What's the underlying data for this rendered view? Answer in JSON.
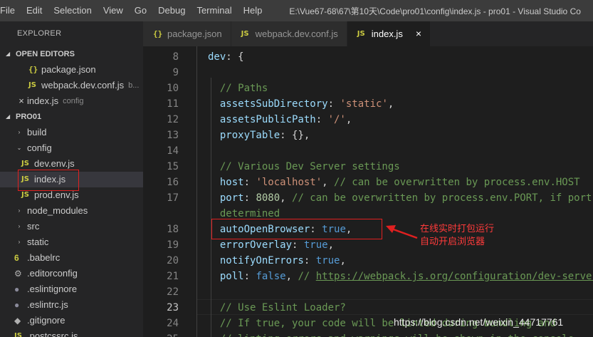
{
  "menubar": {
    "items": [
      "File",
      "Edit",
      "Selection",
      "View",
      "Go",
      "Debug",
      "Terminal",
      "Help"
    ],
    "title": "E:\\Vue67-68\\67\\第10天\\Code\\pro01\\config\\index.js - pro01 - Visual Studio Co"
  },
  "sidebar": {
    "explorer_label": "EXPLORER",
    "open_editors_label": "OPEN EDITORS",
    "open_editors": [
      {
        "icon": "{}",
        "name": "package.json",
        "desc": ""
      },
      {
        "icon": "JS",
        "name": "webpack.dev.conf.js",
        "desc": "b..."
      },
      {
        "icon": "×",
        "name": "index.js",
        "desc": "config"
      }
    ],
    "project_label": "PRO01",
    "tree": [
      {
        "twisty": "›",
        "icon": "",
        "name": "build"
      },
      {
        "twisty": "⌄",
        "icon": "",
        "name": "config"
      },
      {
        "twisty": "",
        "icon": "JS",
        "name": "dev.env.js"
      },
      {
        "twisty": "",
        "icon": "JS",
        "name": "index.js"
      },
      {
        "twisty": "",
        "icon": "JS",
        "name": "prod.env.js"
      },
      {
        "twisty": "›",
        "icon": "",
        "name": "node_modules"
      },
      {
        "twisty": "›",
        "icon": "",
        "name": "src"
      },
      {
        "twisty": "›",
        "icon": "",
        "name": "static"
      },
      {
        "twisty": "",
        "icon": "6",
        "name": ".babelrc"
      },
      {
        "twisty": "",
        "icon": "⚙",
        "name": ".editorconfig"
      },
      {
        "twisty": "",
        "icon": "●",
        "name": ".eslintignore"
      },
      {
        "twisty": "",
        "icon": "●",
        "name": ".eslintrc.js"
      },
      {
        "twisty": "",
        "icon": "◆",
        "name": ".gitignore"
      },
      {
        "twisty": "",
        "icon": "JS",
        "name": ".postcssrc.js"
      }
    ]
  },
  "tabs": [
    {
      "icon": "{}",
      "label": "package.json",
      "active": false
    },
    {
      "icon": "JS",
      "label": "webpack.dev.conf.js",
      "active": false
    },
    {
      "icon": "JS",
      "label": "index.js",
      "active": true,
      "close": "×"
    }
  ],
  "editor": {
    "lines": [
      {
        "no": "8",
        "parts": [
          [
            "k",
            "dev"
          ],
          [
            "p",
            ": {"
          ]
        ]
      },
      {
        "no": "9",
        "parts": []
      },
      {
        "no": "10",
        "parts": [
          [
            "c",
            "  // Paths"
          ]
        ]
      },
      {
        "no": "11",
        "parts": [
          [
            "k",
            "  assetsSubDirectory"
          ],
          [
            "p",
            ": "
          ],
          [
            "s",
            "'static'"
          ],
          [
            "p",
            ","
          ]
        ]
      },
      {
        "no": "12",
        "parts": [
          [
            "k",
            "  assetsPublicPath"
          ],
          [
            "p",
            ": "
          ],
          [
            "s",
            "'/'"
          ],
          [
            "p",
            ","
          ]
        ]
      },
      {
        "no": "13",
        "parts": [
          [
            "k",
            "  proxyTable"
          ],
          [
            "p",
            ": {},"
          ]
        ]
      },
      {
        "no": "14",
        "parts": []
      },
      {
        "no": "15",
        "parts": [
          [
            "c",
            "  // Various Dev Server settings"
          ]
        ]
      },
      {
        "no": "16",
        "parts": [
          [
            "k",
            "  host"
          ],
          [
            "p",
            ": "
          ],
          [
            "s",
            "'localhost'"
          ],
          [
            "p",
            ", "
          ],
          [
            "c",
            "// can be overwritten by process.env.HOST"
          ]
        ]
      },
      {
        "no": "17",
        "parts": [
          [
            "k",
            "  port"
          ],
          [
            "p",
            ": "
          ],
          [
            "n",
            "8080"
          ],
          [
            "p",
            ", "
          ],
          [
            "c",
            "// can be overwritten by process.env.PORT, if port"
          ]
        ]
      },
      {
        "no": "",
        "parts": [
          [
            "c",
            "  determined"
          ]
        ]
      },
      {
        "no": "18",
        "parts": [
          [
            "k",
            "  autoOpenBrowser"
          ],
          [
            "p",
            ": "
          ],
          [
            "b",
            "true"
          ],
          [
            "p",
            ","
          ]
        ]
      },
      {
        "no": "19",
        "parts": [
          [
            "k",
            "  errorOverlay"
          ],
          [
            "p",
            ": "
          ],
          [
            "b",
            "true"
          ],
          [
            "p",
            ","
          ]
        ]
      },
      {
        "no": "20",
        "parts": [
          [
            "k",
            "  notifyOnErrors"
          ],
          [
            "p",
            ": "
          ],
          [
            "b",
            "true"
          ],
          [
            "p",
            ","
          ]
        ]
      },
      {
        "no": "21",
        "parts": [
          [
            "k",
            "  poll"
          ],
          [
            "p",
            ": "
          ],
          [
            "b",
            "false"
          ],
          [
            "p",
            ", "
          ],
          [
            "c",
            "// "
          ],
          [
            "u",
            "https://webpack.js.org/configuration/dev-server"
          ]
        ]
      },
      {
        "no": "22",
        "parts": []
      },
      {
        "no": "23",
        "parts": [
          [
            "c",
            "  // Use Eslint Loader?"
          ]
        ]
      },
      {
        "no": "24",
        "parts": [
          [
            "c",
            "  // If true, your code will be linted during bundling and"
          ]
        ]
      },
      {
        "no": "25",
        "parts": [
          [
            "c",
            "  // linting errors and warnings will be shown in the console."
          ]
        ]
      }
    ],
    "active_line": "23"
  },
  "annotation": {
    "line1": "在线实时打包运行",
    "line2": "自动开启浏览器"
  },
  "watermark": "https://blog.csdn.net/weixin_44717761"
}
